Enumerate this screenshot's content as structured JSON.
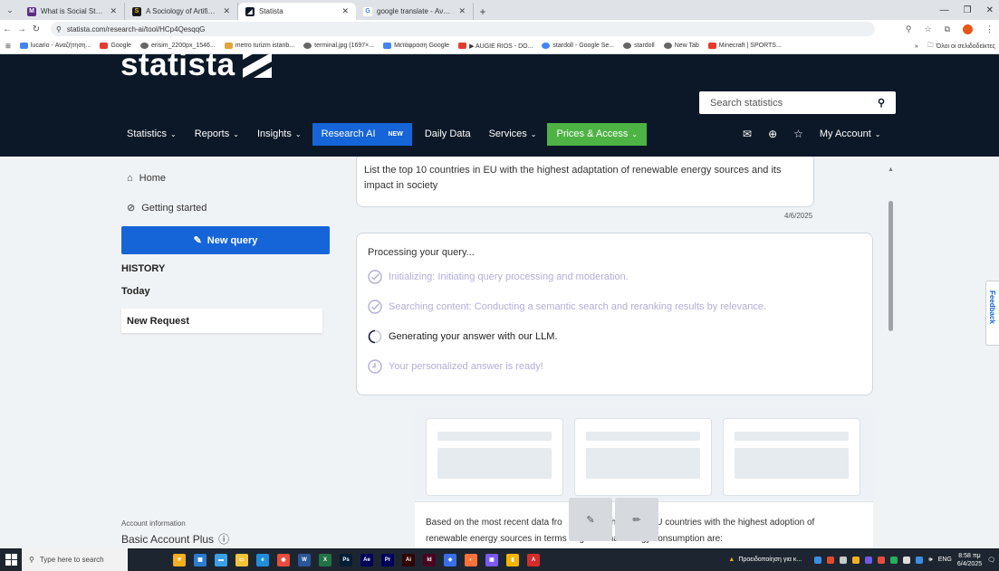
{
  "browser": {
    "tabs": [
      {
        "title": "What is Social Statistics? | Facul",
        "fav_color": "#5b2c83",
        "fav_letter": "M"
      },
      {
        "title": "A Sociology of Artificial Intellige",
        "fav_color": "#1a1a1a",
        "fav_letter": "S"
      },
      {
        "title": "Statista",
        "fav_color": "#0c1827",
        "fav_letter": "◢"
      },
      {
        "title": "google translate - Αναζήτηση",
        "fav_color": "#4285f4",
        "fav_letter": "G"
      }
    ],
    "url": "statista.com/research-ai/tool/HCp4QesqqG",
    "bookmarks": [
      {
        "label": "lucario - Αναζήτηση...",
        "color": "#4285f4"
      },
      {
        "label": "Google",
        "color": "#e33b2e"
      },
      {
        "label": "erisim_2200px_1546...",
        "color": "#555555"
      },
      {
        "label": "metro turizm istanb...",
        "color": "#e0a63a"
      },
      {
        "label": "terminal.jpg (1697×...",
        "color": "#555555"
      },
      {
        "label": "Μετάφραση Google",
        "color": "#4285f4"
      },
      {
        "label": "▶ AUGIE RIOS - DO...",
        "color": "#e33b2e"
      },
      {
        "label": "stardoll - Google Se...",
        "color": "#4285f4"
      },
      {
        "label": "stardoll",
        "color": "#555555"
      },
      {
        "label": "New Tab",
        "color": "#555555"
      },
      {
        "label": "Minecraft | SPORTS...",
        "color": "#e33b2e"
      }
    ],
    "bookmarks_right": "Όλοι οι σελιδοδείκτες"
  },
  "header": {
    "logo": "statista",
    "search_placeholder": "Search statistics",
    "nav": {
      "statistics": "Statistics",
      "reports": "Reports",
      "insights": "Insights",
      "research_ai": "Research AI",
      "research_badge": "NEW",
      "daily_data": "Daily Data",
      "services": "Services",
      "prices": "Prices & Access",
      "my_account": "My Account"
    }
  },
  "sidebar": {
    "home": "Home",
    "getting_started": "Getting started",
    "new_query": "New query",
    "history_heading": "HISTORY",
    "today_heading": "Today",
    "history_items": [
      "New Request"
    ],
    "account_info_label": "Account information",
    "account_plan": "Basic Account Plus"
  },
  "main": {
    "query_text": "List the top 10 countries in EU with the highest adaptation of renewable energy sources and its impact in society",
    "query_date": "4/6/2025",
    "processing_title": "Processing your query...",
    "steps": [
      {
        "text": "Initializing: Initiating query processing and moderation.",
        "state": "done"
      },
      {
        "text": "Searching content: Conducting a semantic search and reranking results by relevance.",
        "state": "done"
      },
      {
        "text": "Generating your answer with our LLM.",
        "state": "active"
      },
      {
        "text": "Your personalized answer is ready!",
        "state": "pending"
      }
    ],
    "answer_line1": "Based on the most recent data fro",
    "answer_line1_mid": "h",
    "answer_line1_end": "U countries with the highest adoption of",
    "answer_line2": "renewable energy sources in terms of gross final energy consumption are:"
  },
  "feedback_label": "Feedback",
  "taskbar": {
    "search_placeholder": "Type here to search",
    "weather_text": "Προειδοποίηση για κ...",
    "language": "ENG",
    "time": "8:58 πμ",
    "date": "6/4/2025"
  },
  "colors": {
    "header_bg": "#0c1827",
    "accent_blue": "#1565d8",
    "accent_green": "#4db344",
    "step_done": "#b3aed8"
  }
}
